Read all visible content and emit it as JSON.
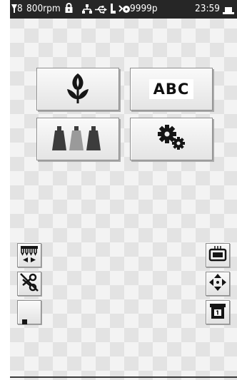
{
  "status_bar": {
    "needle": "8",
    "speed": "800rpm",
    "stitch_count": "9999p",
    "clock": "23:59"
  },
  "main_menu": {
    "pattern_label": "",
    "text_label": "ABC",
    "thread_label": "",
    "settings_label": ""
  },
  "left_tools": [
    "needle-bar-select",
    "trim-cancel",
    "stop"
  ],
  "right_tools": [
    "frame-view",
    "frame-move",
    "hoop-select"
  ],
  "colors": {
    "status_bar_bg": "#262626",
    "icon_dark": "#151515",
    "thread_light": "#9a9a9a",
    "thread_dark": "#3c3c3c"
  }
}
